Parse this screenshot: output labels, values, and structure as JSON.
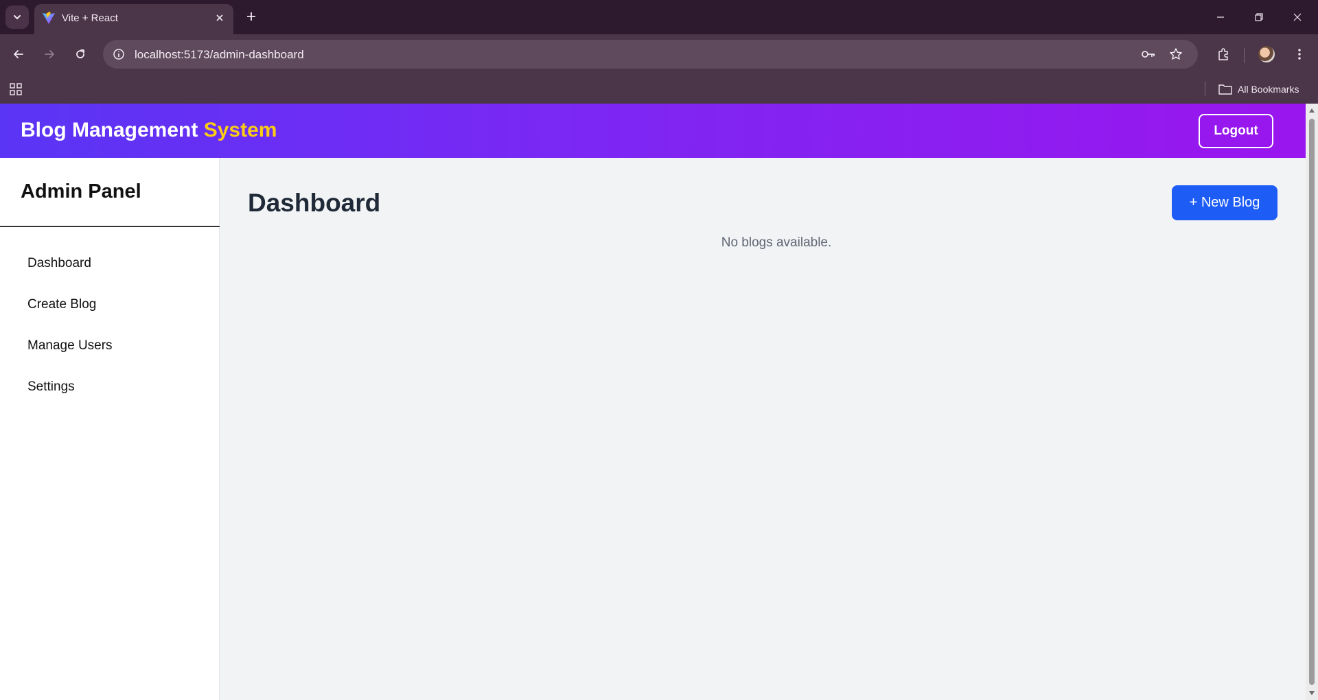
{
  "browser": {
    "tab_title": "Vite + React",
    "url": "localhost:5173/admin-dashboard",
    "bookmarks_label": "All Bookmarks"
  },
  "header": {
    "brand_main": "Blog Management",
    "brand_accent": "System",
    "logout_label": "Logout"
  },
  "sidebar": {
    "title": "Admin Panel",
    "items": [
      {
        "label": "Dashboard"
      },
      {
        "label": "Create Blog"
      },
      {
        "label": "Manage Users"
      },
      {
        "label": "Settings"
      }
    ]
  },
  "main": {
    "title": "Dashboard",
    "new_blog_label": "+ New Blog",
    "empty_message": "No blogs available."
  },
  "colors": {
    "header_gradient_start": "#5a35f5",
    "header_gradient_end": "#9a16ee",
    "brand_accent": "#facc15",
    "primary_button": "#1d5cf5",
    "page_background": "#f2f3f5"
  }
}
